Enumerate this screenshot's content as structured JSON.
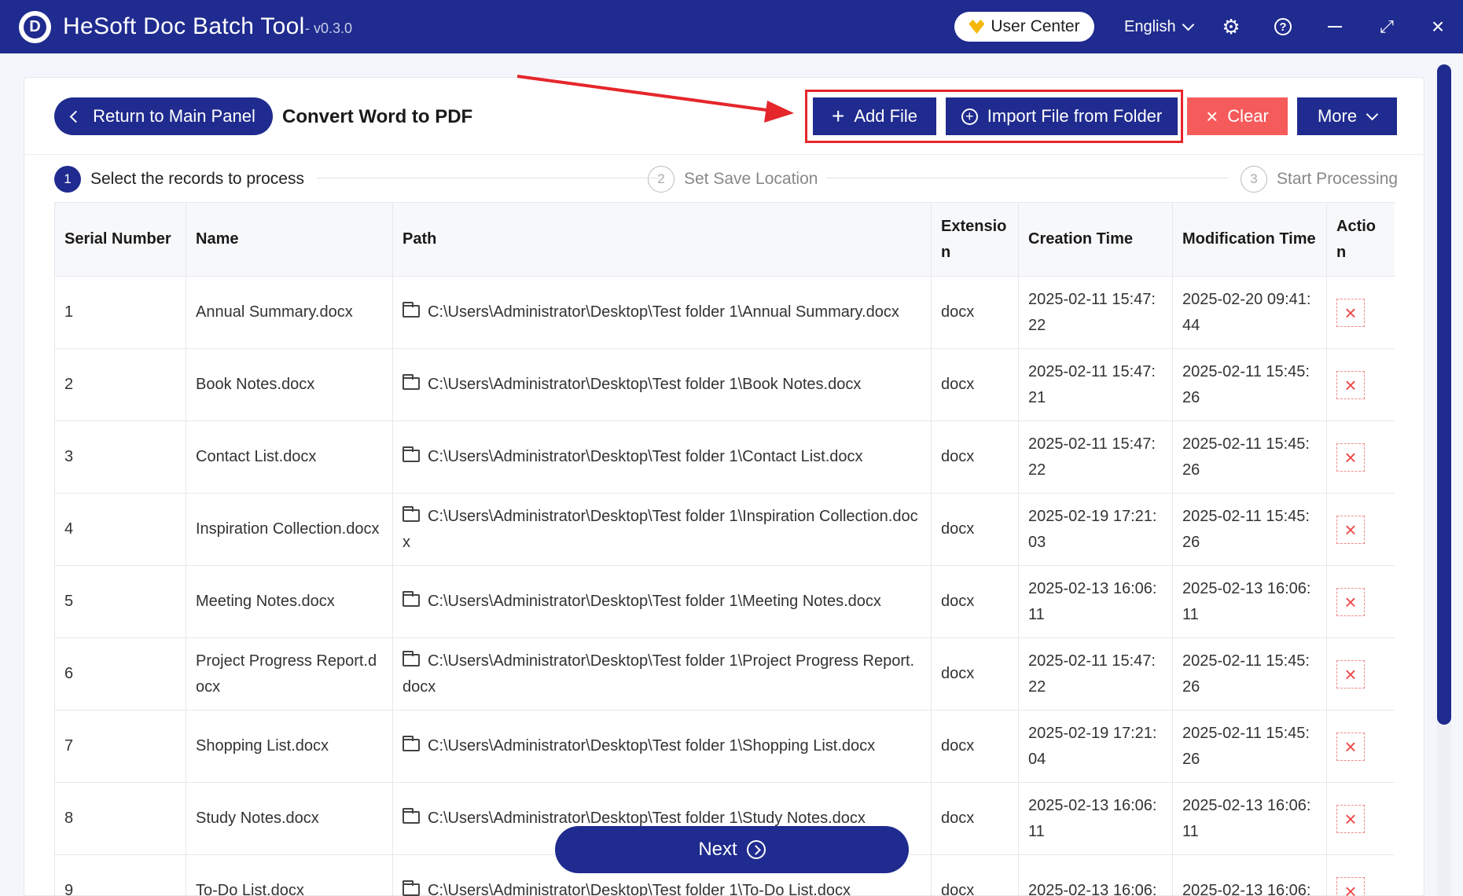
{
  "app": {
    "title": "HeSoft Doc Batch Tool",
    "version": "- v0.3.0",
    "logo_letter": "D",
    "user_center": "User Center",
    "language": "English"
  },
  "toolbar": {
    "return_label": "Return to Main Panel",
    "page_title": "Convert Word to PDF",
    "add_file": "Add File",
    "import_folder": "Import File from Folder",
    "clear": "Clear",
    "more": "More"
  },
  "steps": [
    {
      "num": "1",
      "label": "Select the records to process"
    },
    {
      "num": "2",
      "label": "Set Save Location"
    },
    {
      "num": "3",
      "label": "Start Processing"
    }
  ],
  "table": {
    "headers": [
      "Serial Number",
      "Name",
      "Path",
      "Extension",
      "Creation Time",
      "Modification Time",
      "Action"
    ],
    "rows": [
      {
        "serial": "1",
        "name": "Annual Summary.docx",
        "path": "C:\\Users\\Administrator\\Desktop\\Test folder 1\\Annual Summary.docx",
        "ext": "docx",
        "created": "2025-02-11 15:47:22",
        "modified": "2025-02-20 09:41:44"
      },
      {
        "serial": "2",
        "name": "Book Notes.docx",
        "path": "C:\\Users\\Administrator\\Desktop\\Test folder 1\\Book Notes.docx",
        "ext": "docx",
        "created": "2025-02-11 15:47:21",
        "modified": "2025-02-11 15:45:26"
      },
      {
        "serial": "3",
        "name": "Contact List.docx",
        "path": "C:\\Users\\Administrator\\Desktop\\Test folder 1\\Contact List.docx",
        "ext": "docx",
        "created": "2025-02-11 15:47:22",
        "modified": "2025-02-11 15:45:26"
      },
      {
        "serial": "4",
        "name": "Inspiration Collection.docx",
        "path": "C:\\Users\\Administrator\\Desktop\\Test folder 1\\Inspiration Collection.docx",
        "ext": "docx",
        "created": "2025-02-19 17:21:03",
        "modified": "2025-02-11 15:45:26"
      },
      {
        "serial": "5",
        "name": "Meeting Notes.docx",
        "path": "C:\\Users\\Administrator\\Desktop\\Test folder 1\\Meeting Notes.docx",
        "ext": "docx",
        "created": "2025-02-13 16:06:11",
        "modified": "2025-02-13 16:06:11"
      },
      {
        "serial": "6",
        "name": "Project Progress Report.docx",
        "path": "C:\\Users\\Administrator\\Desktop\\Test folder 1\\Project Progress Report.docx",
        "ext": "docx",
        "created": "2025-02-11 15:47:22",
        "modified": "2025-02-11 15:45:26"
      },
      {
        "serial": "7",
        "name": "Shopping List.docx",
        "path": "C:\\Users\\Administrator\\Desktop\\Test folder 1\\Shopping List.docx",
        "ext": "docx",
        "created": "2025-02-19 17:21:04",
        "modified": "2025-02-11 15:45:26"
      },
      {
        "serial": "8",
        "name": "Study Notes.docx",
        "path": "C:\\Users\\Administrator\\Desktop\\Test folder 1\\Study Notes.docx",
        "ext": "docx",
        "created": "2025-02-13 16:06:11",
        "modified": "2025-02-13 16:06:11"
      },
      {
        "serial": "9",
        "name": "To-Do List.docx",
        "path": "C:\\Users\\Administrator\\Desktop\\Test folder 1\\To-Do List.docx",
        "ext": "docx",
        "created": "2025-02-13 16:06:",
        "modified": "2025-02-13 16:06:"
      }
    ]
  },
  "footer": {
    "next_label": "Next"
  },
  "icons": {
    "logo": "app-logo-icon",
    "user_center": "crown-icon",
    "language": "chevron-down-icon",
    "settings": "gear-icon",
    "help": "help-icon",
    "minimize": "minimize-icon",
    "maximize": "maximize-icon",
    "close": "close-icon",
    "row_folder": "folder-icon",
    "row_delete": "delete-icon"
  },
  "colors": {
    "primary": "#1f2b8e",
    "danger": "#f55b5b",
    "annotation": "#e5262b"
  }
}
